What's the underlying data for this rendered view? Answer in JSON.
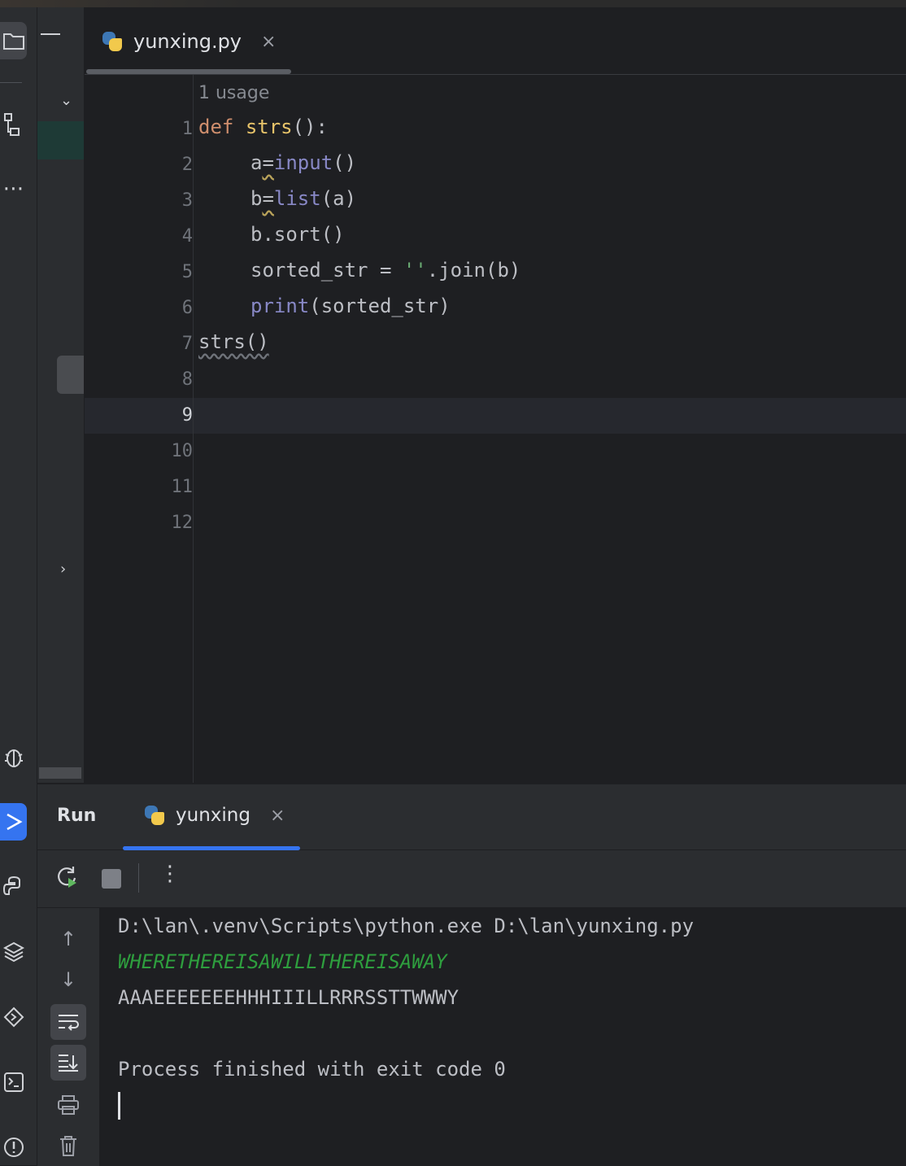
{
  "editor": {
    "tab_title": "yunxing.py",
    "tab_close": "×",
    "usage_hint": "1 usage",
    "line_numbers": [
      "1",
      "2",
      "3",
      "4",
      "5",
      "6",
      "7",
      "8",
      "9",
      "10",
      "11",
      "12"
    ],
    "current_line": "9"
  },
  "code": {
    "l1_kw": "def",
    "l1_name": "strs",
    "l1_rest": "():",
    "l2_a": "a",
    "l2_eq": "=",
    "l2_fn": "input",
    "l2_rest": "()",
    "l3_a": "b",
    "l3_eq": "=",
    "l3_fn": "list",
    "l3_rest": "(a)",
    "l4": "b.sort()",
    "l5_a": "sorted_str = ",
    "l5_str": "''",
    "l5_rest": ".join(b)",
    "l6_fn": "print",
    "l6_rest": "(sorted_str)",
    "l7": "strs()"
  },
  "run": {
    "panel_label": "Run",
    "tab_title": "yunxing",
    "tab_close": "×",
    "console": {
      "command": "D:\\lan\\.venv\\Scripts\\python.exe D:\\lan\\yunxing.py",
      "input": "WHERETHEREISAWILLTHEREISAWAY",
      "output": "AAAEEEEEEEHHHIIILLRRRSSTTWWWY",
      "exit": "Process finished with exit code 0"
    }
  },
  "icons": {
    "project": "folder-icon",
    "structure": "structure-icon",
    "more": "more-icon",
    "debug": "bug-icon",
    "run": "run-icon",
    "python_console": "python-console-icon",
    "layers": "layers-icon",
    "services": "services-icon",
    "terminal": "terminal-icon",
    "problems": "problems-icon",
    "rerun": "rerun-icon",
    "stop": "stop-icon",
    "options": "kebab-icon"
  },
  "colors": {
    "accent": "#3574f0",
    "keyword": "#cf8e6d",
    "builtin": "#8888c6",
    "string": "#6aab73",
    "console_input": "#2e9e3e"
  }
}
